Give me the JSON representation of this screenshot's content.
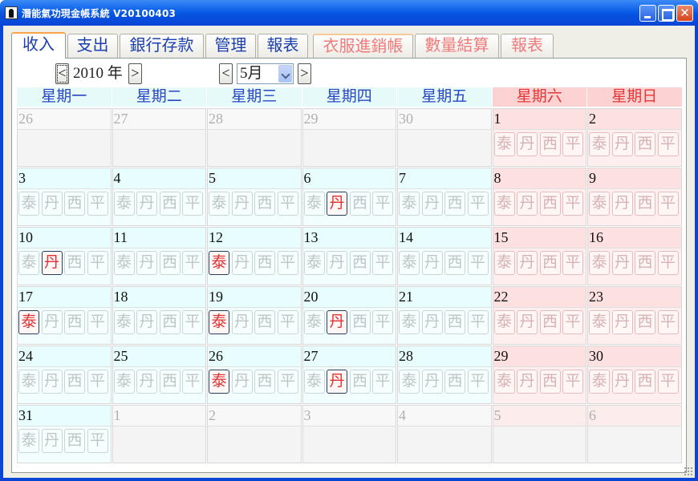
{
  "window": {
    "title": "潛能氣功現金帳系統 V20100403"
  },
  "tabs": [
    {
      "label": "收入",
      "selected": true,
      "color": "#1a3fb0"
    },
    {
      "label": "支出",
      "color": "#1a3fb0"
    },
    {
      "label": "銀行存款",
      "color": "#1a3fb0"
    },
    {
      "label": "管理",
      "color": "#1a3fb0"
    },
    {
      "label": "報表",
      "color": "#1a3fb0"
    },
    {
      "label": "衣服進銷帳",
      "color": "#f07a7a"
    },
    {
      "label": "數量結算",
      "color": "#f07a7a"
    },
    {
      "label": "報表",
      "color": "#f07a7a"
    }
  ],
  "nav": {
    "prev_year": "<",
    "year": "2010 年",
    "next_year": ">",
    "prev_month": "<",
    "month": "5月",
    "next_month": ">"
  },
  "weekdays": [
    "星期一",
    "星期二",
    "星期三",
    "星期四",
    "星期五",
    "星期六",
    "星期日"
  ],
  "chip_labels": [
    "泰",
    "丹",
    "西",
    "平"
  ],
  "colors": {
    "weekday_header_text": "#2746c4",
    "weekend_header_text": "#e83434",
    "active_chip_text": "#e23030"
  },
  "weeks": [
    [
      {
        "d": "26",
        "cur": false
      },
      {
        "d": "27",
        "cur": false
      },
      {
        "d": "28",
        "cur": false
      },
      {
        "d": "29",
        "cur": false
      },
      {
        "d": "30",
        "cur": false
      },
      {
        "d": "1",
        "cur": true,
        "on": []
      },
      {
        "d": "2",
        "cur": true,
        "on": []
      }
    ],
    [
      {
        "d": "3",
        "cur": true,
        "on": []
      },
      {
        "d": "4",
        "cur": true,
        "on": []
      },
      {
        "d": "5",
        "cur": true,
        "on": []
      },
      {
        "d": "6",
        "cur": true,
        "on": [
          1
        ]
      },
      {
        "d": "7",
        "cur": true,
        "on": []
      },
      {
        "d": "8",
        "cur": true,
        "on": []
      },
      {
        "d": "9",
        "cur": true,
        "on": [
          1
        ]
      }
    ],
    [
      {
        "d": "10",
        "cur": true,
        "on": [
          1
        ]
      },
      {
        "d": "11",
        "cur": true,
        "on": []
      },
      {
        "d": "12",
        "cur": true,
        "on": [
          0
        ]
      },
      {
        "d": "13",
        "cur": true,
        "on": []
      },
      {
        "d": "14",
        "cur": true,
        "on": []
      },
      {
        "d": "15",
        "cur": true,
        "on": []
      },
      {
        "d": "16",
        "cur": true,
        "on": []
      }
    ],
    [
      {
        "d": "17",
        "cur": true,
        "on": [
          0
        ]
      },
      {
        "d": "18",
        "cur": true,
        "on": []
      },
      {
        "d": "19",
        "cur": true,
        "on": [
          0
        ]
      },
      {
        "d": "20",
        "cur": true,
        "on": [
          1
        ]
      },
      {
        "d": "21",
        "cur": true,
        "on": []
      },
      {
        "d": "22",
        "cur": true,
        "on": []
      },
      {
        "d": "23",
        "cur": true,
        "on": [
          0,
          1
        ]
      }
    ],
    [
      {
        "d": "24",
        "cur": true,
        "on": []
      },
      {
        "d": "25",
        "cur": true,
        "on": []
      },
      {
        "d": "26",
        "cur": true,
        "on": [
          0
        ]
      },
      {
        "d": "27",
        "cur": true,
        "on": [
          1
        ]
      },
      {
        "d": "28",
        "cur": true,
        "on": []
      },
      {
        "d": "29",
        "cur": true,
        "on": []
      },
      {
        "d": "30",
        "cur": true,
        "on": []
      }
    ],
    [
      {
        "d": "31",
        "cur": true,
        "on": []
      },
      {
        "d": "1",
        "cur": false
      },
      {
        "d": "2",
        "cur": false
      },
      {
        "d": "3",
        "cur": false
      },
      {
        "d": "4",
        "cur": false
      },
      {
        "d": "5",
        "cur": false
      },
      {
        "d": "6",
        "cur": false
      }
    ]
  ]
}
